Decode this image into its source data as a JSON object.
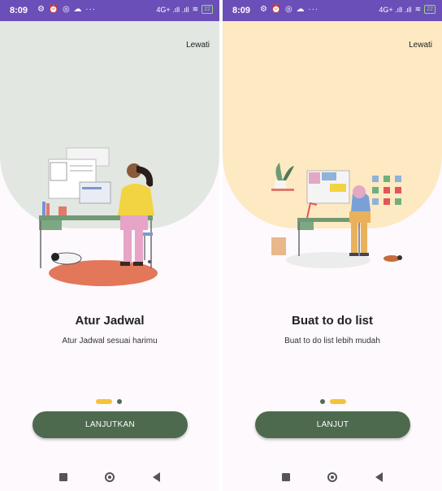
{
  "status_bar": {
    "time": "8:09",
    "left_icons": "⚙ ⏰ ◎ ☁ ···",
    "network": "4G+ .ıll .ıll",
    "wifi": "≋",
    "battery": "22"
  },
  "screens": [
    {
      "skip_label": "Lewati",
      "title": "Atur Jadwal",
      "subtitle": "Atur Jadwal sesuai harimu",
      "button_label": "LANJUTKAN",
      "active_page": 1,
      "page_count": 2,
      "hero_color": "#e2e7e2"
    },
    {
      "skip_label": "Lewati",
      "title": "Buat to do list",
      "subtitle": "Buat to do list lebih mudah",
      "button_label": "LANJUT",
      "active_page": 2,
      "page_count": 2,
      "hero_color": "#fde9c2"
    }
  ],
  "colors": {
    "status_bar": "#6a4fb8",
    "button": "#4d6a4e",
    "indicator_active": "#f6c23a",
    "indicator_inactive": "#4f6b50"
  },
  "nav": {
    "icons": [
      "recent-apps-icon",
      "home-icon",
      "back-icon"
    ]
  }
}
